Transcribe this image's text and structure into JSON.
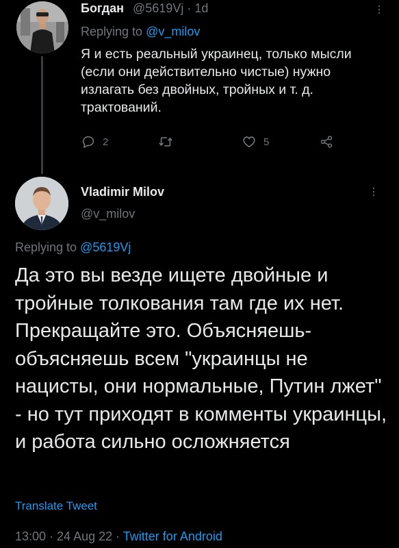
{
  "reply_tweet": {
    "author_name": "Богдан",
    "author_handle": "@5619Vj · 1d",
    "replying_prefix": "Replying to",
    "replying_mention": "@v_milov",
    "text": "Я и есть реальный украинец, только мысли (если они действительно чистые) нужно излагать без двойных, тройных и т. д. трактований.",
    "actions": {
      "reply_count": "2",
      "retweet_count": "",
      "like_count": "5"
    },
    "icons": [
      "reply-icon",
      "retweet-icon",
      "like-icon",
      "share-icon",
      "more-icon"
    ]
  },
  "main_tweet": {
    "author_name": "Vladimir Milov",
    "author_handle": "@v_milov",
    "replying_prefix": "Replying to",
    "replying_mention": "@5619Vj",
    "text": "Да это вы везде ищете двойные и тройные толкования там где их нет. Прекращайте это. Объясняешь-объясняешь всем \"украинцы не нацисты, они нормальные, Путин лжет\" - но тут приходят в комменты украинцы, и работа сильно осложняется",
    "translate_label": "Translate Tweet",
    "timestamp": "13:00 · 24 Aug 22 · ",
    "source": "Twitter for Android"
  },
  "colors": {
    "background": "#000000",
    "text": "#e7e9ea",
    "muted": "#71767b",
    "accent": "#1d9bf0"
  }
}
